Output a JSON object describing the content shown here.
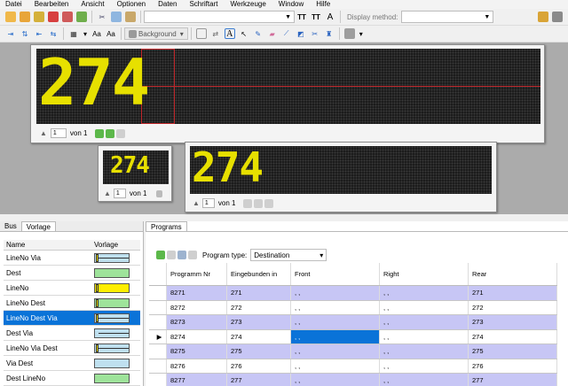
{
  "menu": [
    "Datei",
    "Bearbeiten",
    "Ansicht",
    "Optionen",
    "Daten",
    "Schriftart",
    "Werkzeuge",
    "Window",
    "Hilfe"
  ],
  "toolbar": {
    "display_method_label": "Display method:",
    "background_label": "Background",
    "text_style_label": "A",
    "aa_label1": "Aa",
    "aa_label2": "Aa"
  },
  "preview": {
    "main_sign_text": "274",
    "small_sign_text": "274",
    "medium_sign_text": "274",
    "page": "1",
    "of_label": "von 1"
  },
  "left_panel": {
    "tabs": [
      "Bus",
      "Vorlage"
    ],
    "columns": [
      "Name",
      "Vorlage"
    ],
    "rows": [
      {
        "name": "LineNo Via",
        "swatch": "#bfe0ef"
      },
      {
        "name": "Dest",
        "swatch": "#9ee39a"
      },
      {
        "name": "LineNo",
        "swatch": "#ffee00"
      },
      {
        "name": "LineNo Dest",
        "swatch": "#9ee39a"
      },
      {
        "name": "LineNo Dest Via",
        "swatch": "#bfe0ef"
      },
      {
        "name": "Dest Via",
        "swatch": "#bfe0ef"
      },
      {
        "name": "LineNo Via Dest",
        "swatch": "#bfe0ef"
      },
      {
        "name": "Via Dest",
        "swatch": "#bfe0ef"
      },
      {
        "name": "Dest LineNo",
        "swatch": "#9ee39a"
      }
    ],
    "selected_index": 4
  },
  "right_panel": {
    "tab": "Programs",
    "program_type_label": "Program type:",
    "program_type_value": "Destination",
    "columns": [
      "Programm Nr",
      "Eingebunden in",
      "Front",
      "Right",
      "Rear"
    ],
    "rows": [
      {
        "nr": "8271",
        "in": "271",
        "front": ", ,",
        "right": ", ,",
        "rear": "271"
      },
      {
        "nr": "8272",
        "in": "272",
        "front": ", ,",
        "right": ", ,",
        "rear": "272"
      },
      {
        "nr": "8273",
        "in": "273",
        "front": ", ,",
        "right": ", ,",
        "rear": "273"
      },
      {
        "nr": "8274",
        "in": "274",
        "front": ", ,",
        "right": ", ,",
        "rear": "274"
      },
      {
        "nr": "8275",
        "in": "275",
        "front": ", ,",
        "right": ", ,",
        "rear": "275"
      },
      {
        "nr": "8276",
        "in": "276",
        "front": ", ,",
        "right": ", ,",
        "rear": "276"
      },
      {
        "nr": "8277",
        "in": "277",
        "front": ", ,",
        "right": ", ,",
        "rear": "277"
      }
    ],
    "selected_row": 3
  },
  "colors": {
    "led_on": "#e7e000",
    "selection": "#0a73d8",
    "row_alt": "#c7c6f5"
  }
}
